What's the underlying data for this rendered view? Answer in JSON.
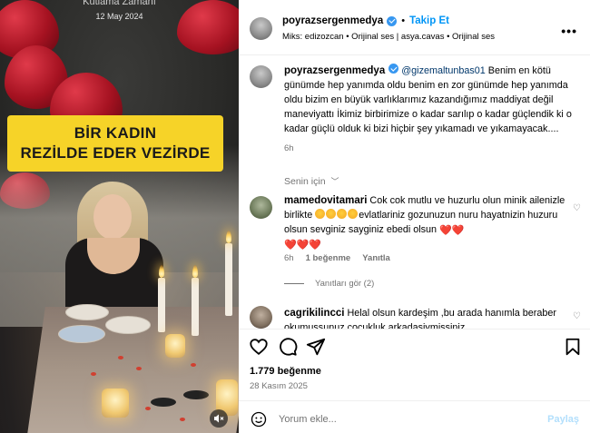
{
  "media": {
    "top_caption": "Kutlama Zamanı",
    "date_caption": "12 May 2024",
    "overlay_line1": "BİR KADIN",
    "overlay_line2": "REZİLDE EDER VEZİRDE",
    "mute_icon": "speaker-muted-icon"
  },
  "header": {
    "username": "poyrazsergenmedya",
    "separator": "•",
    "follow_label": "Takip Et",
    "subtitle": "Miks: edizozcan • Orijinal ses | asya.cavas • Orijinal ses",
    "more_icon": "more-horizontal-icon",
    "more_label": "•••"
  },
  "caption": {
    "username": "poyrazsergenmedya",
    "mention": "@gizemaltunbas01",
    "text": " Benim en kötü günümde hep yanımda oldu benim en zor günümde hep yanımda oldu bizim en büyük varlıklarımız kazandığımız maddiyat değil maneviyattı İkimiz birbirimize o kadar sarılıp o kadar güçlendik ki o kadar güçlü olduk ki bizi hiçbir şey yıkamadı ve yıkamayacak....",
    "time": "6h"
  },
  "filter": {
    "label": "Senin için",
    "chevron": "﹀"
  },
  "comments": [
    {
      "username": "mamedovitamari",
      "text_before": " Cok cok mutlu ve huzurlu olun minik ailenizle birlikte ",
      "text_after": "evlatlariniz gozunuzun nuru hayatnizin huzuru olsun sevginiz sayginiz ebedi olsun ",
      "hearts_inline": "❤️❤️",
      "hearts_line": "❤️❤️❤️",
      "time": "6h",
      "likes": "1 beğenme",
      "reply": "Yanıtla",
      "view_replies": "Yanıtları gör (2)",
      "like_icon": "heart-outline-icon",
      "like_glyph": "♡"
    },
    {
      "username": "cagrikilincci",
      "text": " Helal olsun kardeşim ,bu arada hanımla beraber okumussunuz cocukluk arkadasiymissiniz",
      "like_icon": "heart-outline-icon",
      "like_glyph": "♡"
    }
  ],
  "actions": {
    "like_icon": "heart-outline-icon",
    "comment_icon": "comment-bubble-icon",
    "share_icon": "paper-plane-icon",
    "save_icon": "bookmark-icon"
  },
  "stats": {
    "likes": "1.779 beğenme",
    "date": "28 Kasım 2025"
  },
  "compose": {
    "emoji_icon": "smiley-icon",
    "placeholder": "Yorum ekle...",
    "share_label": "Paylaş"
  },
  "colors": {
    "link_blue": "#0095f6",
    "mention_blue": "#00376b",
    "muted_gray": "#737373",
    "overlay_yellow": "#f6d328",
    "share_disabled": "#b2dffc"
  }
}
